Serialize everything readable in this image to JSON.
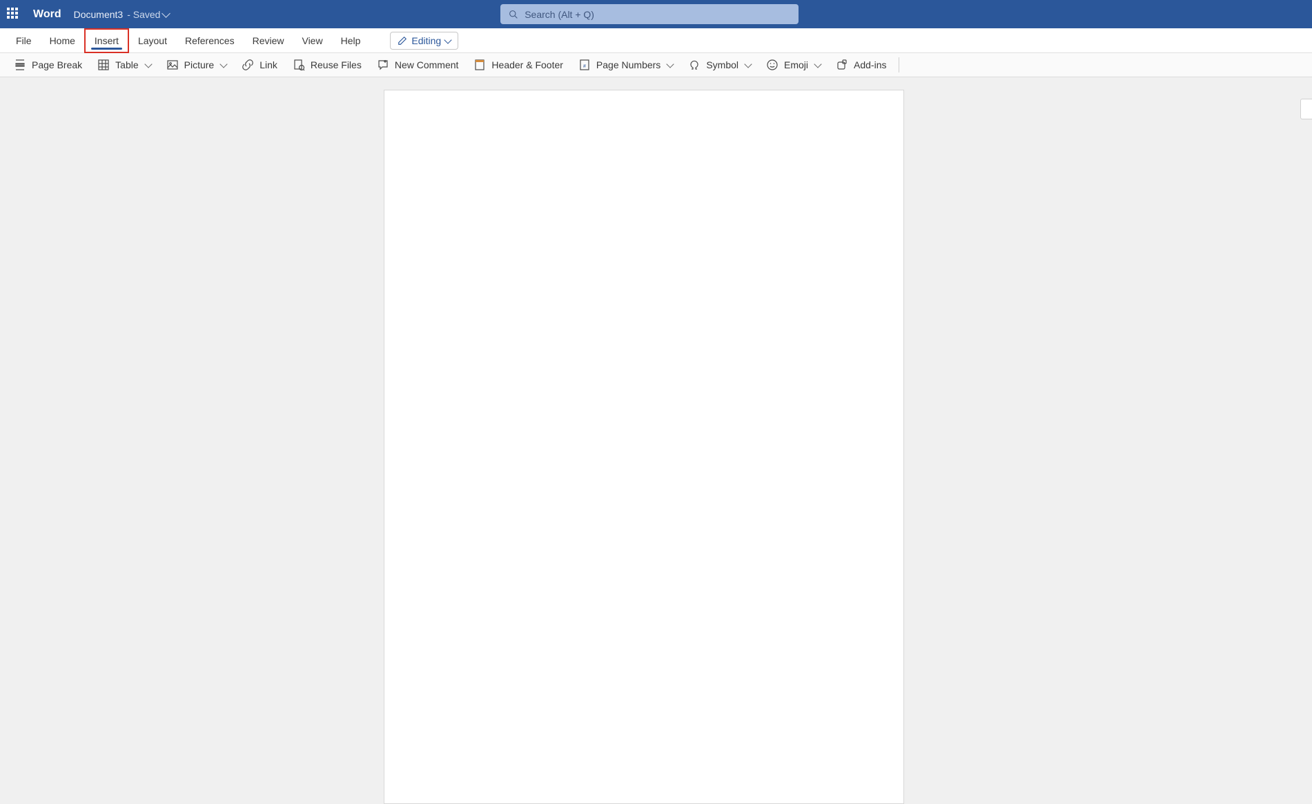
{
  "titlebar": {
    "app": "Word",
    "doc": "Document3",
    "status": "- Saved"
  },
  "search": {
    "placeholder": "Search (Alt + Q)"
  },
  "tabs": [
    "File",
    "Home",
    "Insert",
    "Layout",
    "References",
    "Review",
    "View",
    "Help"
  ],
  "activeTab": "Insert",
  "mode": {
    "label": "Editing"
  },
  "ribbon": {
    "page_break": "Page Break",
    "table": "Table",
    "picture": "Picture",
    "link": "Link",
    "reuse_files": "Reuse Files",
    "new_comment": "New Comment",
    "header_footer": "Header & Footer",
    "page_numbers": "Page Numbers",
    "symbol": "Symbol",
    "emoji": "Emoji",
    "addins": "Add-ins"
  }
}
